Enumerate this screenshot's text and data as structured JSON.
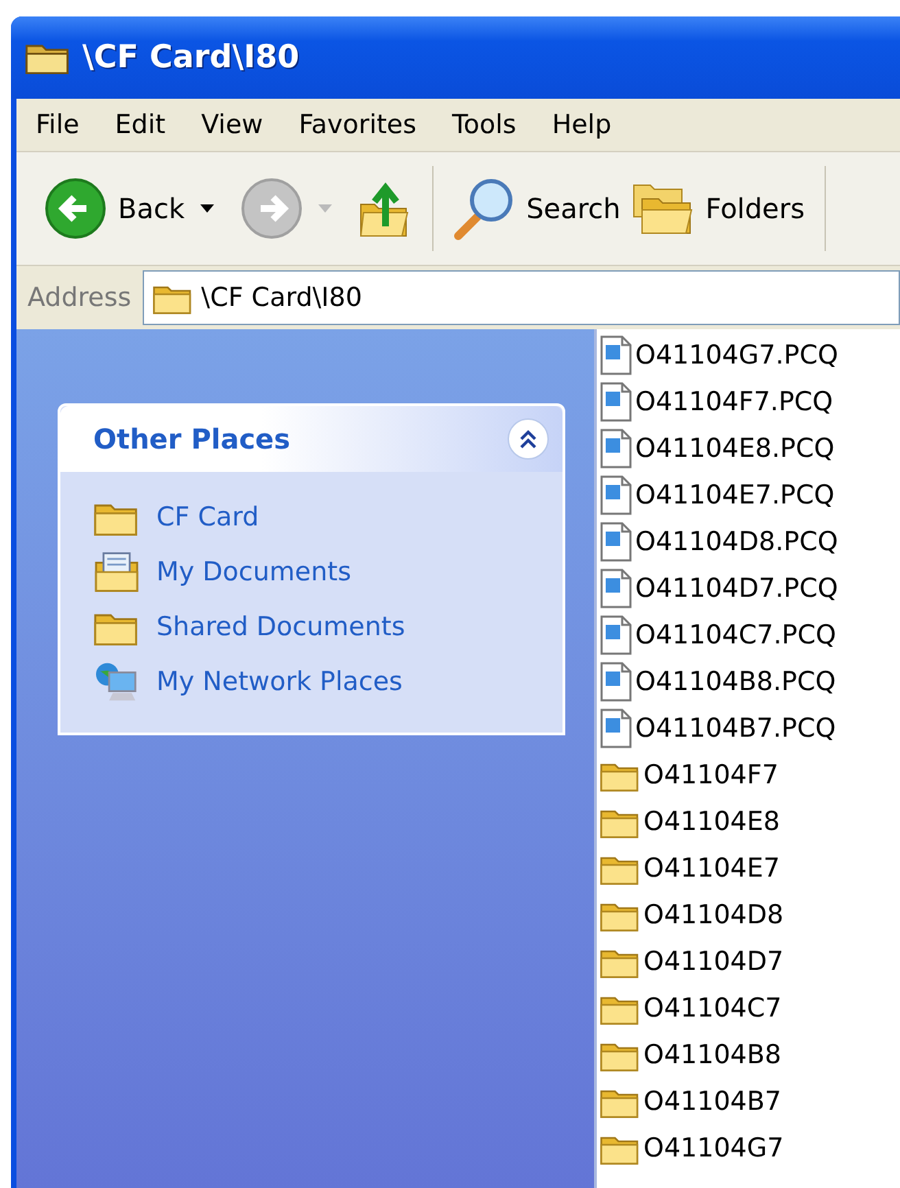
{
  "window": {
    "title": "\\CF Card\\I80"
  },
  "menu": [
    "File",
    "Edit",
    "View",
    "Favorites",
    "Tools",
    "Help"
  ],
  "toolbar": [
    {
      "kind": "back",
      "label": "Back",
      "disabled": false
    },
    {
      "kind": "forward",
      "disabled": true
    },
    {
      "kind": "up"
    },
    {
      "kind": "search",
      "label": "Search"
    },
    {
      "kind": "folders",
      "label": "Folders"
    }
  ],
  "address": {
    "label": "Address",
    "value": "\\CF Card\\I80"
  },
  "other_places": {
    "title": "Other Places",
    "expanded": true,
    "items": [
      {
        "kind": "folder",
        "label": "CF Card"
      },
      {
        "kind": "documents",
        "label": "My Documents"
      },
      {
        "kind": "folder",
        "label": "Shared Documents"
      },
      {
        "kind": "network",
        "label": "My Network Places"
      }
    ]
  },
  "files": [
    {
      "kind": "file",
      "name": "O41104G7.PCQ"
    },
    {
      "kind": "file",
      "name": "O41104F7.PCQ"
    },
    {
      "kind": "file",
      "name": "O41104E8.PCQ"
    },
    {
      "kind": "file",
      "name": "O41104E7.PCQ"
    },
    {
      "kind": "file",
      "name": "O41104D8.PCQ"
    },
    {
      "kind": "file",
      "name": "O41104D7.PCQ"
    },
    {
      "kind": "file",
      "name": "O41104C7.PCQ"
    },
    {
      "kind": "file",
      "name": "O41104B8.PCQ"
    },
    {
      "kind": "file",
      "name": "O41104B7.PCQ"
    },
    {
      "kind": "folder",
      "name": "O41104F7"
    },
    {
      "kind": "folder",
      "name": "O41104E8"
    },
    {
      "kind": "folder",
      "name": "O41104E7"
    },
    {
      "kind": "folder",
      "name": "O41104D8"
    },
    {
      "kind": "folder",
      "name": "O41104D7"
    },
    {
      "kind": "folder",
      "name": "O41104C7"
    },
    {
      "kind": "folder",
      "name": "O41104B8"
    },
    {
      "kind": "folder",
      "name": "O41104B7"
    },
    {
      "kind": "folder",
      "name": "O41104G7"
    }
  ]
}
